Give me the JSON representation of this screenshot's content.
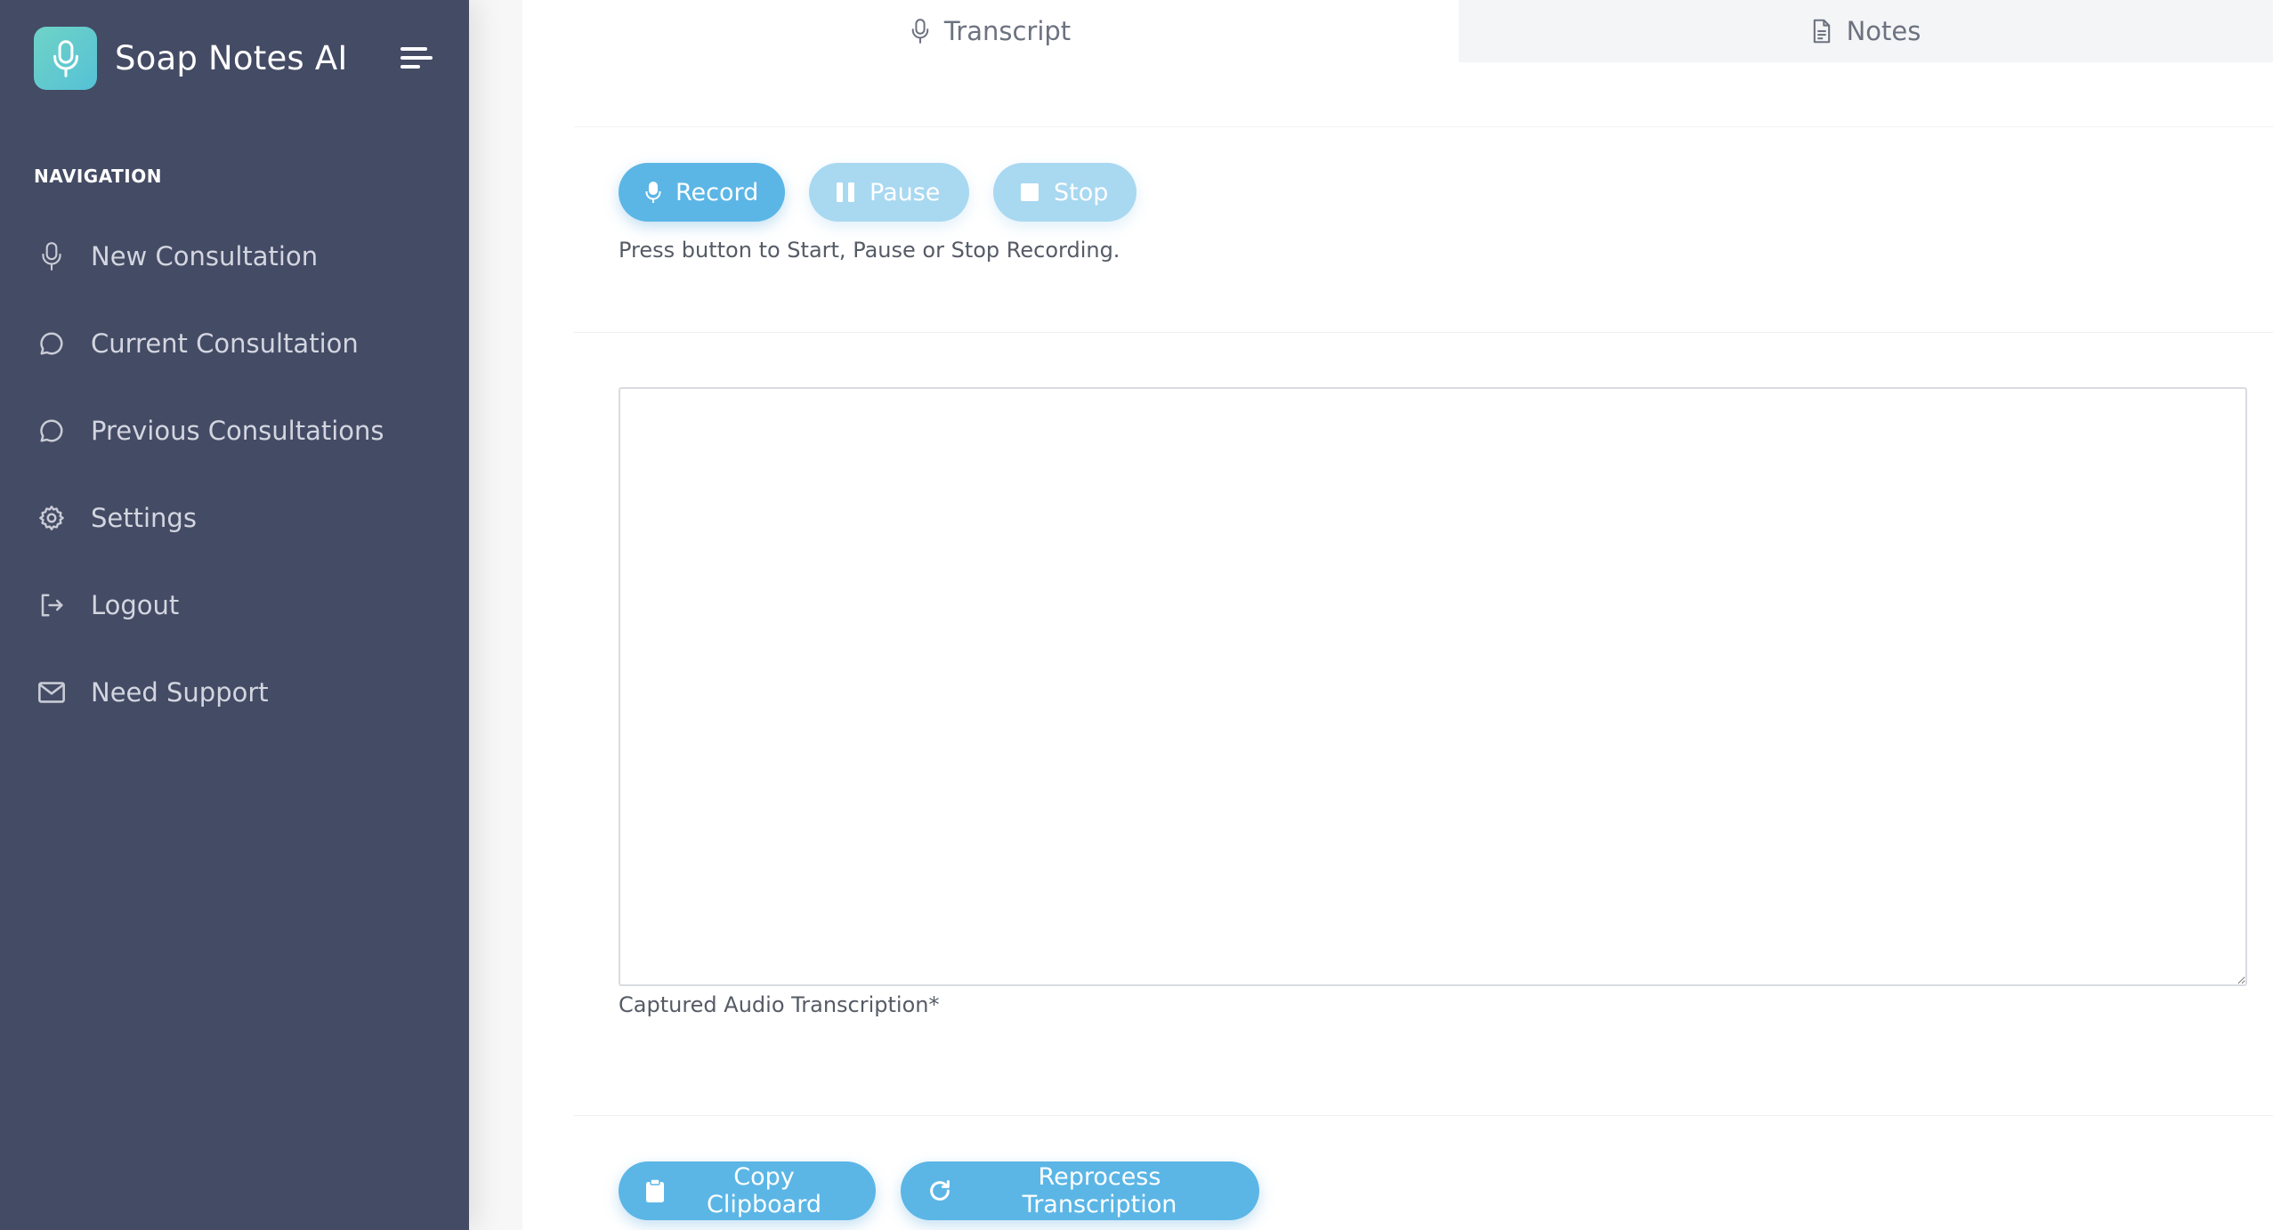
{
  "app": {
    "title": "Soap Notes AI",
    "logo_icon": "microphone-icon",
    "menu_icon": "menu-toggle-icon"
  },
  "sidebar": {
    "heading": "NAVIGATION",
    "items": [
      {
        "label": "New Consultation",
        "icon": "microphone-icon"
      },
      {
        "label": "Current Consultation",
        "icon": "chat-bubble-icon"
      },
      {
        "label": "Previous Consultations",
        "icon": "chat-bubble-icon"
      },
      {
        "label": "Settings",
        "icon": "gear-icon"
      },
      {
        "label": "Logout",
        "icon": "logout-icon"
      },
      {
        "label": "Need Support",
        "icon": "mail-icon"
      }
    ]
  },
  "tabs": [
    {
      "label": "Transcript",
      "icon": "microphone-icon",
      "active": true
    },
    {
      "label": "Notes",
      "icon": "document-icon",
      "active": false
    }
  ],
  "recorder": {
    "record_label": "Record",
    "pause_label": "Pause",
    "stop_label": "Stop",
    "hint": "Press button to Start, Pause or Stop Recording."
  },
  "transcript": {
    "value": "",
    "label": "Captured Audio Transcription*"
  },
  "actions": {
    "copy_label": "Copy Clipboard",
    "reprocess_label": "Reprocess Transcription"
  },
  "colors": {
    "sidebar_bg": "#444b64",
    "accent": "#5bb6e6",
    "accent_disabled": "#a9d8f1",
    "logo_gradient_start": "#6fd3c6",
    "logo_gradient_end": "#55c1d6"
  }
}
